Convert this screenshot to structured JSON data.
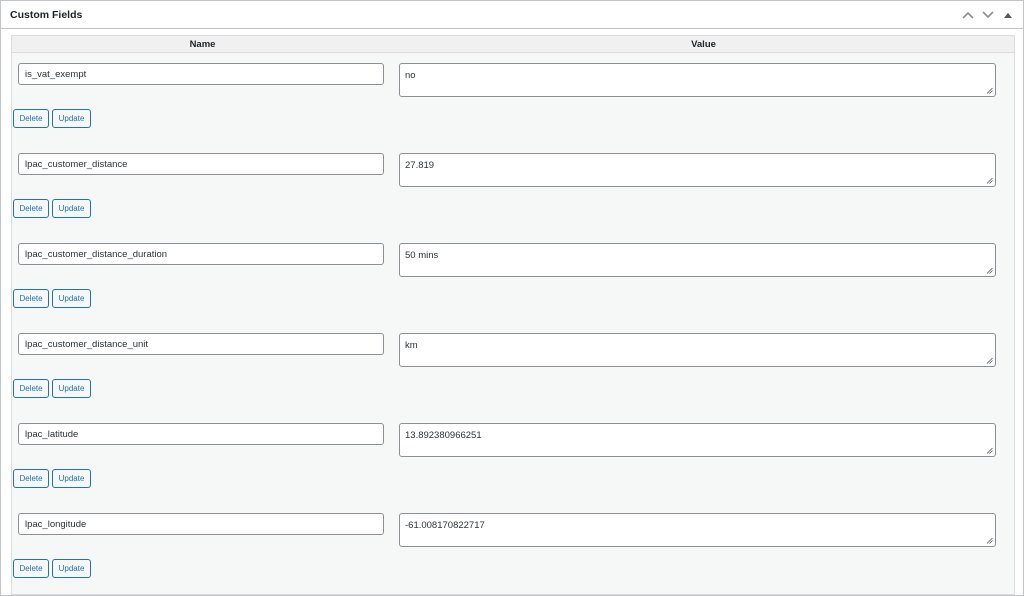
{
  "panel": {
    "title": "Custom Fields",
    "columns": {
      "name": "Name",
      "value": "Value"
    }
  },
  "buttons": {
    "delete": "Delete",
    "update": "Update"
  },
  "fields": [
    {
      "key": "is_vat_exempt",
      "value": "no"
    },
    {
      "key": "lpac_customer_distance",
      "value": "27.819"
    },
    {
      "key": "lpac_customer_distance_duration",
      "value": "50 mins"
    },
    {
      "key": "lpac_customer_distance_unit",
      "value": "km"
    },
    {
      "key": "lpac_latitude",
      "value": "13.892380966251"
    },
    {
      "key": "lpac_longitude",
      "value": "-61.008170822717"
    }
  ],
  "icons": {
    "move_up": "chevron-up-icon",
    "move_down": "chevron-down-icon",
    "toggle": "caret-up-icon"
  },
  "colors": {
    "accent": "#2271b1",
    "border": "#c3c4c7",
    "inner_bg": "#f6f7f7"
  }
}
